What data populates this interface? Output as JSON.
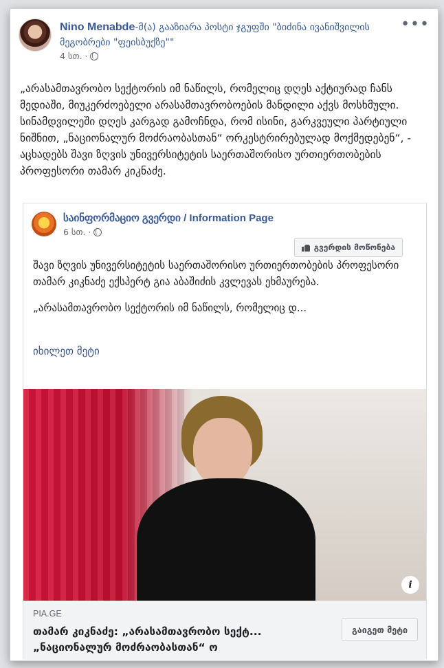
{
  "post": {
    "author": "Nino Menabde",
    "shared_text": "-მ(ა) გააზიარა პოსტი ჯგუფში \"ბიძინა ივანიშვილის მეგობრები \"ფეისბუქზე\"\"",
    "time": "4 სთ. ·",
    "body": "„არასამთავრობო სექტორის იმ ნაწილს, რომელიც დღეს აქტიურად ჩანს მედიაში, მიუკერძოებელი არასამთავრობოების მანდილი აქვს მოსხმული. სინამდვილეში დღეს კარგად გამოჩნდა, რომ ისინი, გარკვეული პარტიული ნიშნით, „ნაციონალურ მოძრაობასთან“ ორკესტრირებულად მოქმედებენ“, - აცხადებს შავი ზღვის უნივერსიტეტის საერთაშორისო ურთიერთობების პროფესორი თამარ კიკნაძე."
  },
  "shared": {
    "page_name": "საინფორმაციო გვერდი / Information Page",
    "time": "6 სთ. ·",
    "like_page_label": "გვერდის მოწონება",
    "paragraph1": "შავი ზღვის უნივერსიტეტის საერთაშორისო ურთიერთობების პროფესორი თამარ კიკნაძე ექსპერტ გია აბაშიძის კვლევას ეხმაურება.",
    "paragraph2": "„არასამთავრობო სექტორის იმ ნაწილს, რომელიც დ...",
    "see_more": "იხილეთ მეტი"
  },
  "link": {
    "domain": "PIA.GE",
    "title": "თამარ კიკნაძე: „არასამთავრობო სექტ... „ნაციონალურ მოძრაობასთან“ ო",
    "learn_more_label": "გაიგეთ მეტი"
  },
  "icons": {
    "more": "more-options-icon",
    "privacy": "globe-icon",
    "like": "thumbs-up-icon",
    "info": "info-icon"
  },
  "colors": {
    "link_blue": "#385898",
    "meta_gray": "#616770",
    "footer_bg": "#f2f3f5"
  }
}
